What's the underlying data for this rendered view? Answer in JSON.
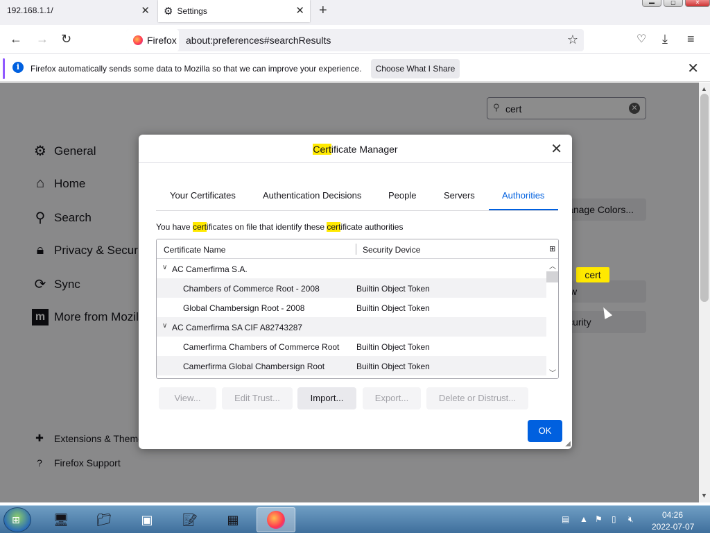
{
  "browser": {
    "tabs": [
      {
        "title": "192.168.1.1/"
      },
      {
        "title": "Settings"
      }
    ],
    "url_identity": "Firefox",
    "url": "about:preferences#searchResults"
  },
  "notification": {
    "text": "Firefox automatically sends some data to Mozilla so that we can improve your experience.",
    "button": "Choose What I Share"
  },
  "settings": {
    "categories": [
      {
        "label": "General",
        "icon": "gear-icon"
      },
      {
        "label": "Home",
        "icon": "home-icon"
      },
      {
        "label": "Search",
        "icon": "search-icon"
      },
      {
        "label": "Privacy & Security",
        "icon": "lock-icon"
      },
      {
        "label": "Sync",
        "icon": "sync-icon"
      },
      {
        "label": "More from Mozilla",
        "icon": "mozilla-icon"
      }
    ],
    "footer": [
      {
        "label": "Extensions & Themes",
        "icon": "puzzle-icon"
      },
      {
        "label": "Firefox Support",
        "icon": "help-icon"
      }
    ],
    "search_value": "cert",
    "search_highlight": "cert",
    "buttons": {
      "manage_colors": "Manage Colors...",
      "view_certificates": "View Certificates...",
      "security_devices": "Security Devices..."
    }
  },
  "dialog": {
    "title_hl": "Cert",
    "title_rest": "ificate Manager",
    "tabs": [
      "Your Certificates",
      "Authentication Decisions",
      "People",
      "Servers",
      "Authorities"
    ],
    "active_tab": "Authorities",
    "desc": {
      "a": "You have ",
      "b": "cert",
      "c": "ificates on file that identify these ",
      "d": "cert",
      "e": "ificate authorities"
    },
    "columns": [
      "Certificate Name",
      "Security Device"
    ],
    "rows": [
      {
        "type": "group",
        "name": "AC Camerfirma S.A.",
        "device": ""
      },
      {
        "type": "item",
        "name": "Chambers of Commerce Root - 2008",
        "device": "Builtin Object Token"
      },
      {
        "type": "item",
        "name": "Global Chambersign Root - 2008",
        "device": "Builtin Object Token"
      },
      {
        "type": "group",
        "name": "AC Camerfirma SA CIF A82743287",
        "device": ""
      },
      {
        "type": "item",
        "name": "Camerfirma Chambers of Commerce Root",
        "device": "Builtin Object Token"
      },
      {
        "type": "item",
        "name": "Camerfirma Global Chambersign Root",
        "device": "Builtin Object Token"
      }
    ],
    "buttons": {
      "view": "View...",
      "edit_trust": "Edit Trust...",
      "import": "Import...",
      "export": "Export...",
      "delete": "Delete or Distrust...",
      "ok": "OK"
    }
  },
  "taskbar": {
    "time": "04:26",
    "date": "2022-07-07"
  },
  "colors": {
    "accent": "#0060df",
    "highlight": "#ffe900"
  }
}
